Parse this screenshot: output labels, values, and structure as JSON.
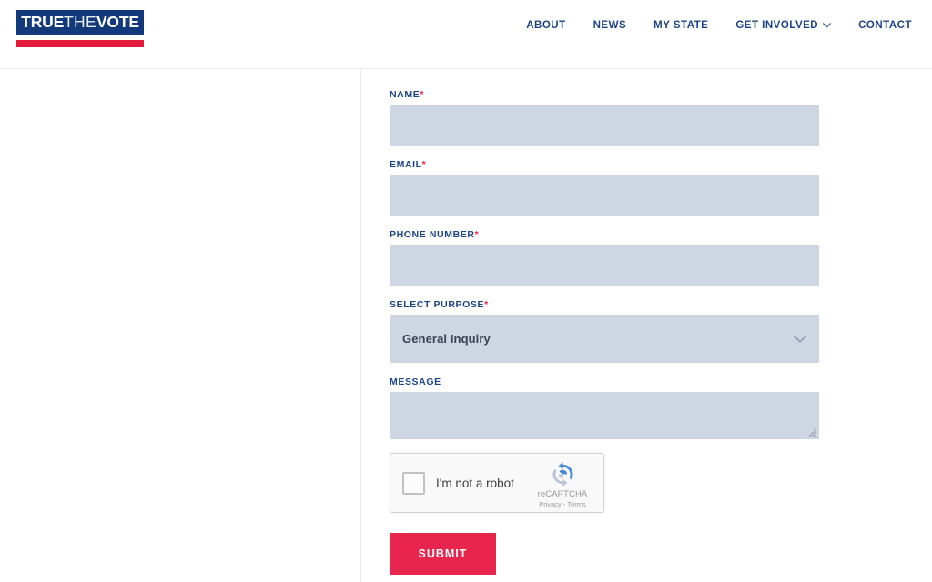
{
  "header": {
    "logo": {
      "part1": "TRUE",
      "part2": "THE",
      "part3": "VOTE",
      "box_color": "#123a7a",
      "bar_color": "#e31b3d"
    },
    "nav": [
      {
        "label": "ABOUT",
        "has_caret": false
      },
      {
        "label": "NEWS",
        "has_caret": false
      },
      {
        "label": "MY STATE",
        "has_caret": false
      },
      {
        "label": "GET INVOLVED",
        "has_caret": true
      },
      {
        "label": "CONTACT",
        "has_caret": false
      }
    ],
    "nav_color": "#1c4587"
  },
  "form": {
    "required_marker": "*",
    "fields": {
      "name": {
        "label": "NAME",
        "required": true,
        "value": "",
        "placeholder": ""
      },
      "email": {
        "label": "EMAIL",
        "required": true,
        "value": "",
        "placeholder": ""
      },
      "phone": {
        "label": "PHONE NUMBER",
        "required": true,
        "value": "",
        "placeholder": ""
      },
      "purpose": {
        "label": "SELECT PURPOSE",
        "required": true,
        "selected": "General Inquiry",
        "caret_icon": "chevron-down-icon"
      },
      "message": {
        "label": "MESSAGE",
        "required": false,
        "value": "",
        "placeholder": ""
      }
    },
    "recaptcha": {
      "checkbox_label": "I'm not a robot",
      "brand": "reCAPTCHA",
      "privacy": "Privacy",
      "separator": " - ",
      "terms": "Terms",
      "logo_icon": "recaptcha-logo-icon"
    },
    "submit": {
      "label": "SUBMIT",
      "color": "#e8254d"
    }
  },
  "theme": {
    "input_bg": "#ced5e3",
    "label_blue": "#1c4587",
    "required_red": "#e8254d",
    "page_bg": "#ffffff",
    "column_border": "#e9e9e9"
  }
}
